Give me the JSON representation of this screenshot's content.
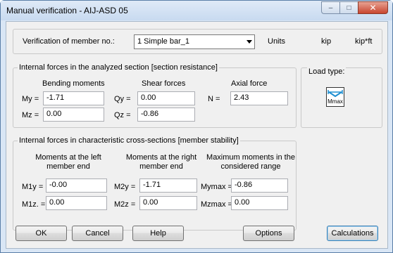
{
  "window": {
    "title": "Manual verification - AIJ-ASD 05",
    "buttons": {
      "minimize": "–",
      "maximize": "□",
      "close": "✕"
    }
  },
  "member": {
    "label": "Verification of member no.:",
    "selected": "1 Simple bar_1",
    "units_label": "Units",
    "unit_force": "kip",
    "unit_moment": "kip*ft"
  },
  "section": {
    "title": "Internal forces in the analyzed section [section resistance]",
    "bending_header": "Bending moments",
    "shear_header": "Shear forces",
    "axial_header": "Axial force",
    "my_label": "My =",
    "my_value": "-1.71",
    "mz_label": "Mz =",
    "mz_value": "0.00",
    "qy_label": "Qy =",
    "qy_value": "0.00",
    "qz_label": "Qz =",
    "qz_value": "-0.86",
    "n_label": "N =",
    "n_value": "2.43"
  },
  "load_type": {
    "title": "Load type:",
    "icon": "mmax-load-icon",
    "icon_text": "Mmax"
  },
  "stability": {
    "title": "Internal forces in characteristic cross-sections [member stability]",
    "left_header_1": "Moments at the left",
    "left_header_2": "member end",
    "right_header_1": "Moments at the right",
    "right_header_2": "member end",
    "max_header_1": "Maximum moments in the",
    "max_header_2": "considered range",
    "m1y_label": "M1y =",
    "m1y_value": "-0.00",
    "m1z_label": "M1z. =",
    "m1z_value": "0.00",
    "m2y_label": "M2y =",
    "m2y_value": "-1.71",
    "m2z_label": "M2z =",
    "m2z_value": "0.00",
    "mymax_label": "Mymax =",
    "mymax_value": "-0.86",
    "mzmax_label": "Mzmax =",
    "mzmax_value": "0.00"
  },
  "footer": {
    "ok": "OK",
    "cancel": "Cancel",
    "help": "Help",
    "options": "Options",
    "calculations": "Calculations"
  }
}
